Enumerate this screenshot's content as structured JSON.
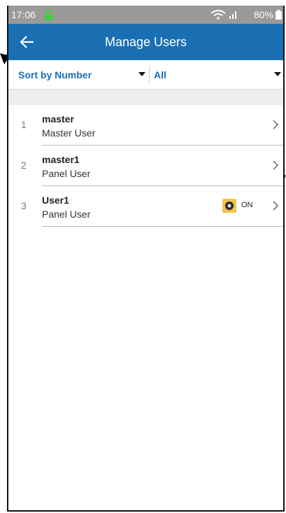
{
  "status_bar": {
    "time": "17:06",
    "battery": "80%",
    "lock_icon": "lock-icon",
    "wifi_icon": "wifi-icon",
    "signal_icon": "signal-icon",
    "battery_icon": "battery-icon"
  },
  "app_bar": {
    "title": "Manage Users",
    "back_icon": "arrow-left-icon",
    "color": "#1a6fb3"
  },
  "filters": {
    "sort": "Sort by Number",
    "type": "All"
  },
  "users": [
    {
      "number": "1",
      "name": "master",
      "type": "Master User"
    },
    {
      "number": "2",
      "name": "master1",
      "type": "Panel User"
    },
    {
      "number": "3",
      "name": "User1",
      "type": "Panel User",
      "status": "ON",
      "status_icon": "tag-icon",
      "status_color": "#f2c14e"
    }
  ],
  "colors": {
    "accent": "#1a6fb3",
    "status_bar": "#9a9a9a",
    "divider": "#bdbdbd",
    "gap": "#eeeeee"
  }
}
